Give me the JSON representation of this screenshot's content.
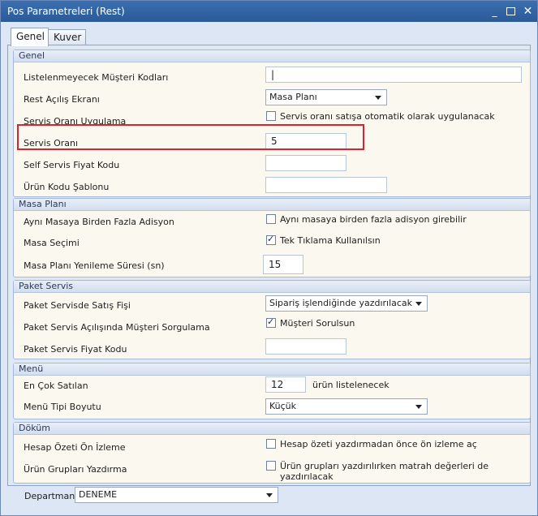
{
  "window": {
    "title": "Pos Parametreleri (Rest)",
    "min": "_",
    "close": "✕"
  },
  "tabs": [
    {
      "label": "Genel"
    },
    {
      "label": "Kuver"
    }
  ],
  "groups": {
    "genel": {
      "header": "Genel",
      "rows": [
        {
          "label": "Listelenmeyecek Müşteri Kodları",
          "value": "|"
        },
        {
          "label": "Rest Açılış Ekranı",
          "value": "Masa Planı"
        },
        {
          "label": "Servis Oranı Uygulama",
          "checkbox_label": "Servis oranı satışa otomatik olarak uygulanacak",
          "checked": false
        },
        {
          "label": "Servis Oranı",
          "value": "5"
        },
        {
          "label": "Self Servis Fiyat Kodu",
          "value": ""
        },
        {
          "label": "Ürün Kodu Şablonu",
          "value": ""
        }
      ]
    },
    "masa": {
      "header": "Masa Planı",
      "rows": [
        {
          "label": "Aynı Masaya Birden Fazla Adisyon",
          "checkbox_label": "Aynı masaya birden fazla adisyon girebilir",
          "checked": false
        },
        {
          "label": "Masa Seçimi",
          "checkbox_label": "Tek Tıklama Kullanılsın",
          "checked": true
        },
        {
          "label": "Masa Planı Yenileme Süresi (sn)",
          "value": "15"
        }
      ]
    },
    "paket": {
      "header": "Paket Servis",
      "rows": [
        {
          "label": "Paket Servisde Satış Fişi",
          "value": "Sipariş işlendiğinde yazdırılacak"
        },
        {
          "label": "Paket Servis Açılışında Müşteri Sorgulama",
          "checkbox_label": "Müşteri Sorulsun",
          "checked": true
        },
        {
          "label": "Paket Servis Fiyat Kodu",
          "value": ""
        }
      ]
    },
    "menu": {
      "header": "Menü",
      "rows": [
        {
          "label": "En Çok Satılan",
          "value": "12",
          "suffix": "ürün listelenecek"
        },
        {
          "label": "Menü Tipi Boyutu",
          "value": "Küçük"
        }
      ]
    },
    "dokum": {
      "header": "Döküm",
      "rows": [
        {
          "label": "Hesap Özeti Ön İzleme",
          "checkbox_label": "Hesap özeti yazdırmadan önce ön izleme aç",
          "checked": false
        },
        {
          "label": "Ürün Grupları Yazdırma",
          "checkbox_label": "Ürün grupları yazdırılırken matrah değerleri de yazdırılacak",
          "checked": false
        }
      ]
    }
  },
  "departman": {
    "label": "Departman",
    "value": "DENEME"
  },
  "colors": {
    "titlebar": "#2f64a6",
    "highlight": "#e0202a",
    "group_bg": "#fbf8ef"
  }
}
